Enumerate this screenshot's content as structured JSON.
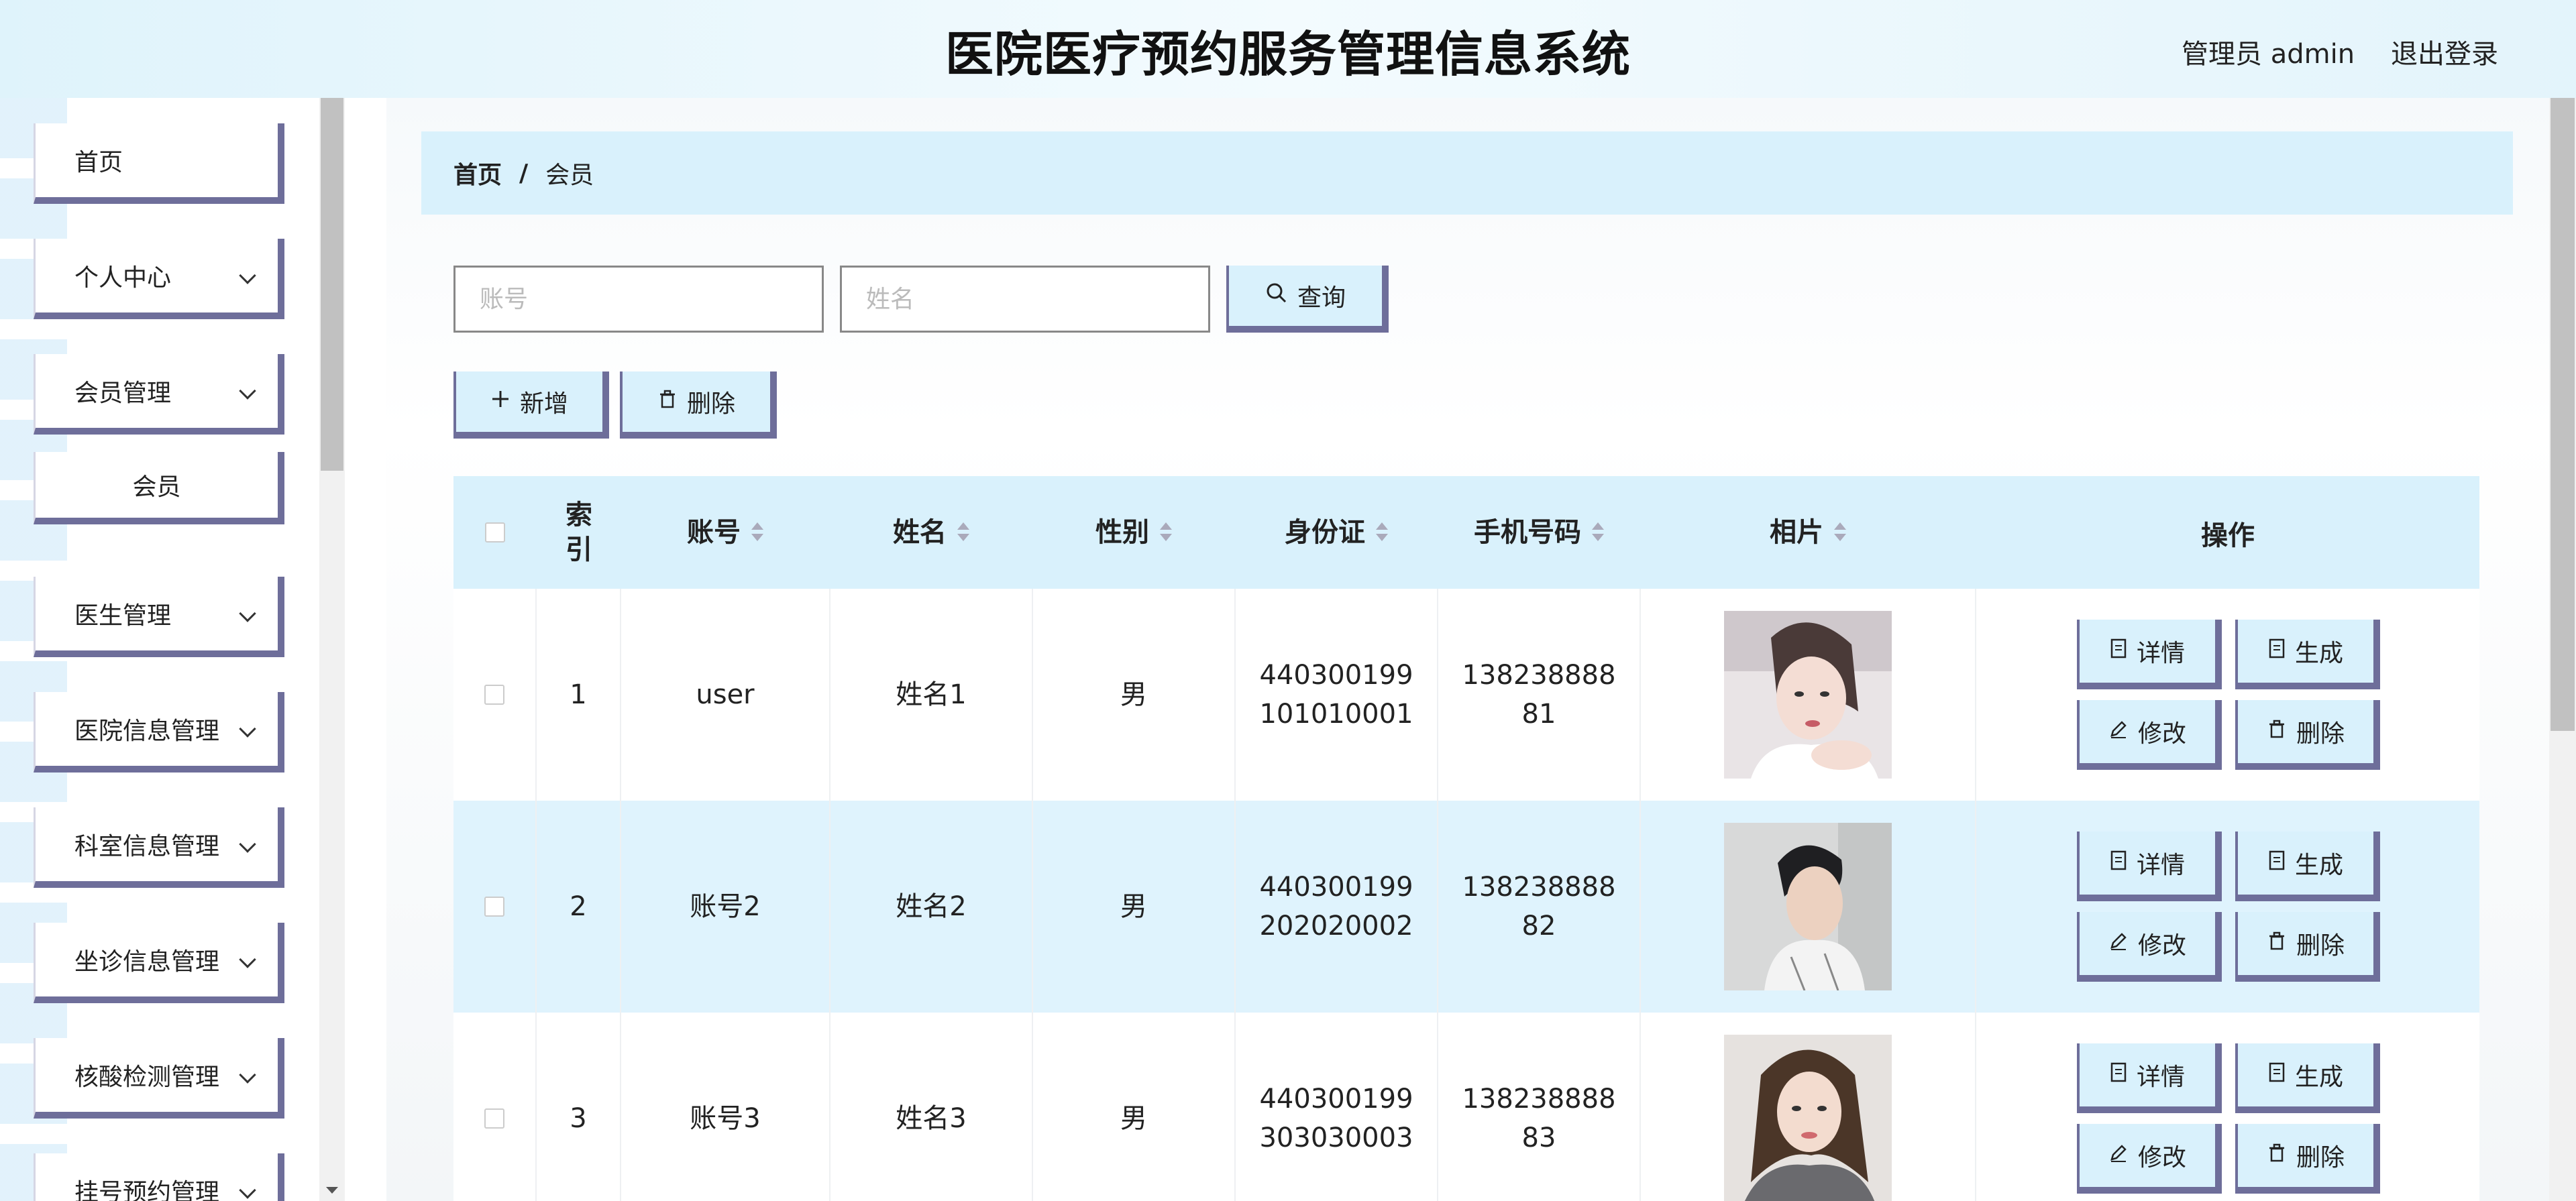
{
  "header": {
    "title": "医院医疗预约服务管理信息系统",
    "user": "管理员 admin",
    "logout": "退出登录"
  },
  "sidebar": {
    "items": [
      {
        "label": "首页"
      },
      {
        "label": "个人中心"
      },
      {
        "label": "会员管理"
      },
      {
        "label": "会员"
      },
      {
        "label": "医生管理"
      },
      {
        "label": "医院信息管理"
      },
      {
        "label": "科室信息管理"
      },
      {
        "label": "坐诊信息管理"
      },
      {
        "label": "核酸检测管理"
      },
      {
        "label": "挂号预约管理"
      }
    ]
  },
  "breadcrumb": {
    "home": "首页",
    "separator": "/",
    "current": "会员"
  },
  "search": {
    "account_placeholder": "账号",
    "name_placeholder": "姓名",
    "query_label": "查询"
  },
  "toolbar": {
    "add_label": "新增",
    "delete_label": "删除"
  },
  "table": {
    "headers": {
      "index": "索\n引",
      "account": "账号",
      "name": "姓名",
      "gender": "性别",
      "id_card": "身份证",
      "phone": "手机号码",
      "photo": "相片",
      "actions": "操作"
    },
    "rows": [
      {
        "index": "1",
        "account": "user",
        "name": "姓名1",
        "gender": "男",
        "id_card": "440300199101010001",
        "phone": "13823888881",
        "photo": "female-portrait-1"
      },
      {
        "index": "2",
        "account": "账号2",
        "name": "姓名2",
        "gender": "男",
        "id_card": "440300199202020002",
        "phone": "13823888882",
        "photo": "male-portrait-2"
      },
      {
        "index": "3",
        "account": "账号3",
        "name": "姓名3",
        "gender": "男",
        "id_card": "440300199303030003",
        "phone": "13823888883",
        "photo": "female-portrait-3"
      }
    ],
    "row_actions": {
      "detail": "详情",
      "generate": "生成",
      "edit": "修改",
      "delete": "删除"
    }
  },
  "colors": {
    "accent": "#d9f1fc",
    "button_border": "#6e6e9a",
    "row_alt": "#dff3fd"
  }
}
